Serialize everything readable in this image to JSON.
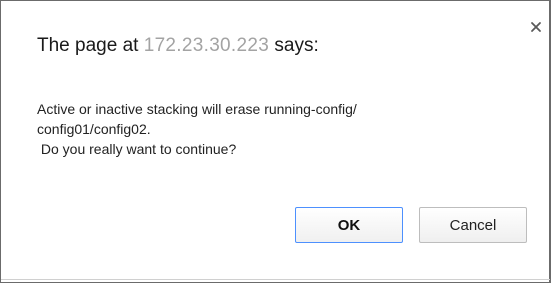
{
  "dialog": {
    "title_prefix": "The page at ",
    "title_host": "172.23.30.223",
    "title_suffix": " says:",
    "message_lines": [
      "Active or inactive stacking will erase running-config/",
      "config01/config02.",
      " Do you really want to continue?"
    ],
    "ok_label": "OK",
    "cancel_label": "Cancel",
    "close_icon": "close-icon"
  },
  "colors": {
    "ok_border": "#4d90fe",
    "text": "#222222",
    "frame": "#6b6b6b"
  }
}
